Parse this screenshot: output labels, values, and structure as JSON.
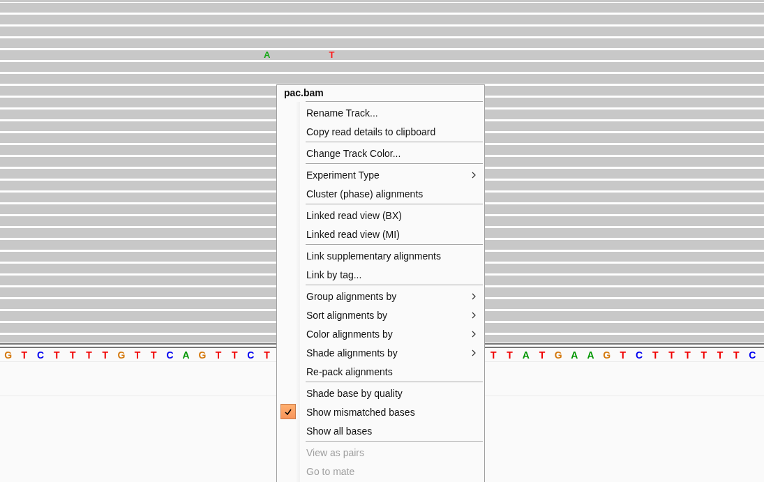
{
  "alignments": {
    "mismatches": [
      {
        "base": "A",
        "color": "#12a812"
      },
      {
        "base": "T",
        "color": "#ff1a1a"
      }
    ]
  },
  "reference": {
    "left_bases": [
      {
        "base": "G",
        "color": "#d4780c"
      },
      {
        "base": "T",
        "color": "#f00000"
      },
      {
        "base": "C",
        "color": "#0000f0"
      },
      {
        "base": "T",
        "color": "#f00000"
      },
      {
        "base": "T",
        "color": "#f00000"
      },
      {
        "base": "T",
        "color": "#f00000"
      },
      {
        "base": "T",
        "color": "#f00000"
      },
      {
        "base": "G",
        "color": "#d4780c"
      },
      {
        "base": "T",
        "color": "#f00000"
      },
      {
        "base": "T",
        "color": "#f00000"
      },
      {
        "base": "C",
        "color": "#0000f0"
      },
      {
        "base": "A",
        "color": "#009600"
      },
      {
        "base": "G",
        "color": "#d4780c"
      },
      {
        "base": "T",
        "color": "#f00000"
      },
      {
        "base": "T",
        "color": "#f00000"
      },
      {
        "base": "C",
        "color": "#0000f0"
      },
      {
        "base": "T",
        "color": "#f00000"
      }
    ],
    "right_bases": [
      {
        "base": "T",
        "color": "#f00000"
      },
      {
        "base": "T",
        "color": "#f00000"
      },
      {
        "base": "A",
        "color": "#009600"
      },
      {
        "base": "T",
        "color": "#f00000"
      },
      {
        "base": "G",
        "color": "#d4780c"
      },
      {
        "base": "A",
        "color": "#009600"
      },
      {
        "base": "A",
        "color": "#009600"
      },
      {
        "base": "G",
        "color": "#d4780c"
      },
      {
        "base": "T",
        "color": "#f00000"
      },
      {
        "base": "C",
        "color": "#0000f0"
      },
      {
        "base": "T",
        "color": "#f00000"
      },
      {
        "base": "T",
        "color": "#f00000"
      },
      {
        "base": "T",
        "color": "#f00000"
      },
      {
        "base": "T",
        "color": "#f00000"
      },
      {
        "base": "T",
        "color": "#f00000"
      },
      {
        "base": "T",
        "color": "#f00000"
      },
      {
        "base": "C",
        "color": "#0000f0"
      }
    ]
  },
  "context_menu": {
    "title": "pac.bam",
    "sections": [
      {
        "items": [
          {
            "label": "Rename Track...",
            "submenu": false,
            "checked": false,
            "disabled": false
          },
          {
            "label": "Copy read details to clipboard",
            "submenu": false,
            "checked": false,
            "disabled": false
          }
        ]
      },
      {
        "items": [
          {
            "label": "Change Track Color...",
            "submenu": false,
            "checked": false,
            "disabled": false
          }
        ]
      },
      {
        "items": [
          {
            "label": "Experiment Type",
            "submenu": true,
            "checked": false,
            "disabled": false
          },
          {
            "label": "Cluster (phase) alignments",
            "submenu": false,
            "checked": false,
            "disabled": false
          }
        ]
      },
      {
        "items": [
          {
            "label": "Linked read view (BX)",
            "submenu": false,
            "checked": false,
            "disabled": false
          },
          {
            "label": "Linked read view (MI)",
            "submenu": false,
            "checked": false,
            "disabled": false
          }
        ]
      },
      {
        "items": [
          {
            "label": "Link supplementary alignments",
            "submenu": false,
            "checked": false,
            "disabled": false
          },
          {
            "label": "Link by tag...",
            "submenu": false,
            "checked": false,
            "disabled": false
          }
        ]
      },
      {
        "items": [
          {
            "label": "Group alignments by",
            "submenu": true,
            "checked": false,
            "disabled": false
          },
          {
            "label": "Sort alignments by",
            "submenu": true,
            "checked": false,
            "disabled": false
          },
          {
            "label": "Color alignments by",
            "submenu": true,
            "checked": false,
            "disabled": false
          },
          {
            "label": "Shade alignments by",
            "submenu": true,
            "checked": false,
            "disabled": false
          },
          {
            "label": "Re-pack alignments",
            "submenu": false,
            "checked": false,
            "disabled": false
          }
        ]
      },
      {
        "items": [
          {
            "label": "Shade base by quality",
            "submenu": false,
            "checked": false,
            "disabled": false
          },
          {
            "label": "Show mismatched bases",
            "submenu": false,
            "checked": true,
            "disabled": false
          },
          {
            "label": "Show all bases",
            "submenu": false,
            "checked": false,
            "disabled": false
          }
        ]
      },
      {
        "items": [
          {
            "label": "View as pairs",
            "submenu": false,
            "checked": false,
            "disabled": true
          },
          {
            "label": "Go to mate",
            "submenu": false,
            "checked": false,
            "disabled": true
          }
        ]
      }
    ]
  }
}
